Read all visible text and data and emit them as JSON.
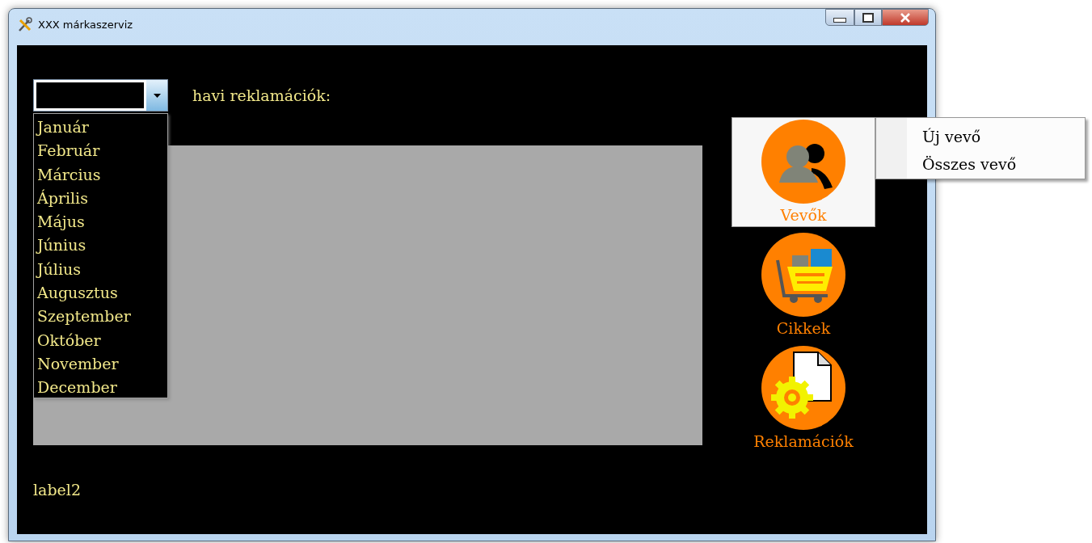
{
  "window": {
    "title": "XXX márkaszerviz"
  },
  "month_combo": {
    "expanded": true,
    "options": [
      {
        "label": "Január",
        "selected": false
      },
      {
        "label": "Február",
        "selected": false
      },
      {
        "label": "Március",
        "selected": false
      },
      {
        "label": "Április",
        "selected": false
      },
      {
        "label": "Május",
        "selected": false
      },
      {
        "label": "Június",
        "selected": false
      },
      {
        "label": "Július",
        "selected": false
      },
      {
        "label": "Augusztus",
        "selected": false
      },
      {
        "label": "Szeptember",
        "selected": false
      },
      {
        "label": "Október",
        "selected": false
      },
      {
        "label": "November",
        "selected": false
      },
      {
        "label": "December",
        "selected": false
      }
    ]
  },
  "heading": "havi reklamációk:",
  "status_label": "label2",
  "nav_buttons": [
    {
      "label": "Vevők",
      "kind": "people",
      "selected": true
    },
    {
      "label": "Cikkek",
      "kind": "cart",
      "selected": false
    },
    {
      "label": "Reklamációk",
      "kind": "document-gear",
      "selected": false
    }
  ],
  "context_menu": {
    "items": [
      "Új vevő",
      "Összes vevő"
    ]
  }
}
